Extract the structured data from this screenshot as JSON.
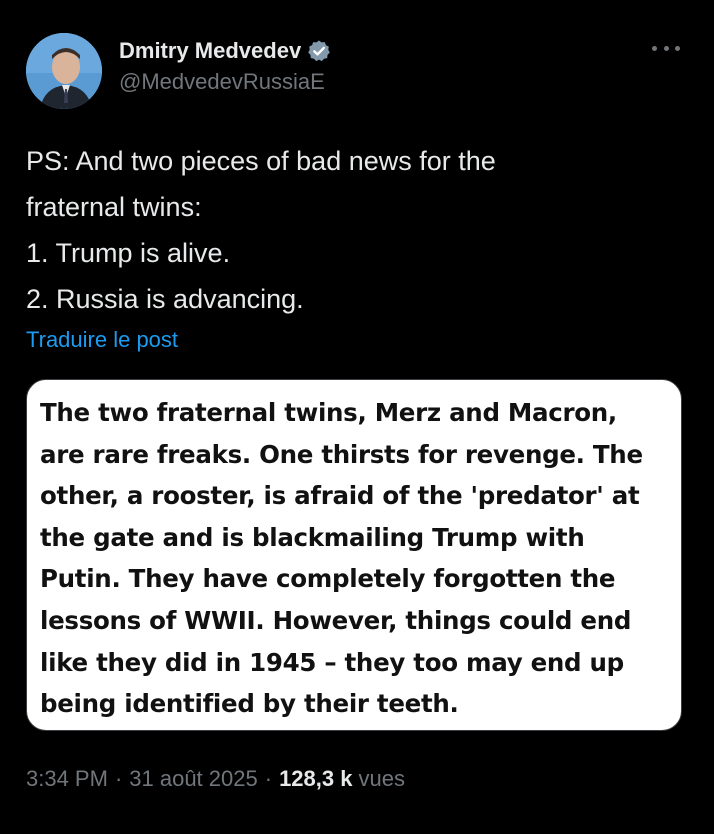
{
  "author": {
    "display_name": "Dmitry Medvedev",
    "handle": "@MedvedevRussiaE",
    "verified": true
  },
  "tweet": {
    "text_lines": [
      "PS: And two pieces of bad news for the",
      "fraternal twins:",
      "1. Trump is alive.",
      "2. Russia is advancing."
    ],
    "translate_label": "Traduire le post"
  },
  "media": {
    "text_lines": [
      "The two fraternal twins, Merz and Macron,",
      "are rare freaks. One thirsts for revenge. The",
      "other, a rooster, is afraid of the 'predator' at",
      "the gate and is blackmailing Trump with",
      "Putin. They have completely forgotten the",
      "lessons of WWII. However, things could end",
      "like they did in 1945 – they too may end up",
      "being identified by their teeth."
    ]
  },
  "meta": {
    "time": "3:34 PM",
    "separator": "·",
    "date": "31 août 2025",
    "views_count": "128,3 k",
    "views_label": "vues"
  },
  "icons": {
    "verified": "verified-badge-icon",
    "more": "more-options-icon"
  },
  "colors": {
    "background": "#000000",
    "text_primary": "#e7e9ea",
    "text_secondary": "#71767b",
    "link": "#1d9bf0",
    "verified_badge": "#829aab"
  }
}
